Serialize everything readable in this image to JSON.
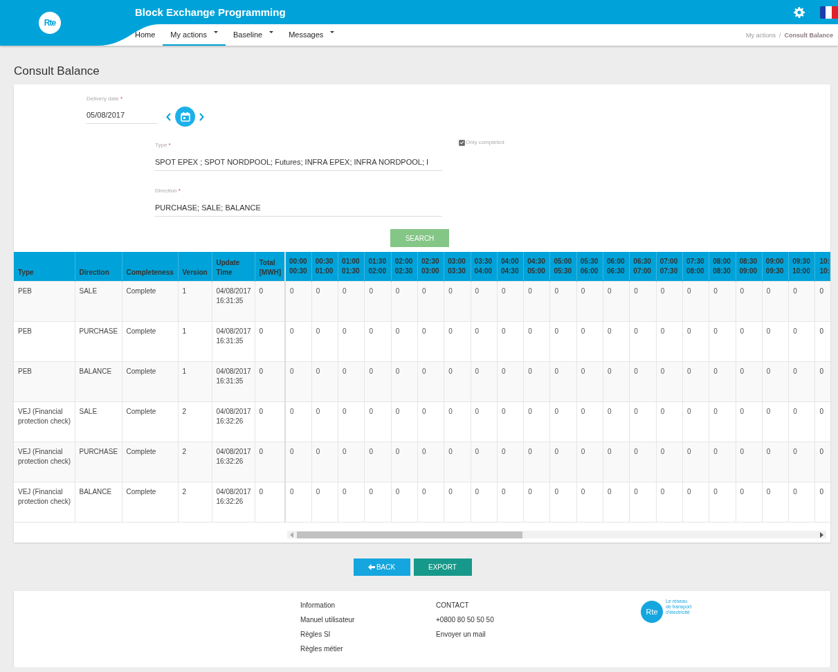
{
  "header": {
    "logo_text": "Rte",
    "title": "Block Exchange Programming"
  },
  "nav": [
    {
      "label": "Home",
      "selected": false,
      "dropdown": false
    },
    {
      "label": "My actions",
      "selected": true,
      "dropdown": true
    },
    {
      "label": "Baseline",
      "selected": false,
      "dropdown": true
    },
    {
      "label": "Messages",
      "selected": false,
      "dropdown": true
    }
  ],
  "breadcrumb": {
    "items": [
      "My actions",
      "Consult Balance"
    ],
    "separator": "/"
  },
  "page_title": "Consult Balance",
  "form": {
    "delivery_date": {
      "label": "Delivery date",
      "marker": "*",
      "value": "05/08/2017"
    },
    "type": {
      "label": "Type",
      "marker": "*",
      "value": "SPOT EPEX ; SPOT NORDPOOL; Futures; INFRA EPEX; INFRA NORDPOOL; I"
    },
    "only_completed": {
      "label": "Only completed",
      "checked": true
    },
    "direction": {
      "label": "Direction",
      "marker": "*",
      "value": "PURCHASE; SALE; BALANCE"
    },
    "search_button": {
      "label": "SEARCH",
      "disabled": true
    }
  },
  "table": {
    "columns": [
      {
        "label": "Type",
        "kind": "type"
      },
      {
        "label": "Direction",
        "kind": "direction"
      },
      {
        "label": "Completeness",
        "kind": "completeness"
      },
      {
        "label": "Version",
        "kind": "version"
      },
      {
        "label": "Update Time",
        "kind": "time"
      },
      {
        "label": "Total [MWH]",
        "kind": "total"
      },
      {
        "label": "00:00 00:30",
        "kind": "slot"
      },
      {
        "label": "00:30 01:00",
        "kind": "slot"
      },
      {
        "label": "01:00 01:30",
        "kind": "slot"
      },
      {
        "label": "01:30 02:00",
        "kind": "slot"
      },
      {
        "label": "02:00 02:30",
        "kind": "slot"
      },
      {
        "label": "02:30 03:00",
        "kind": "slot"
      },
      {
        "label": "03:00 03:30",
        "kind": "slot"
      },
      {
        "label": "03:30 04:00",
        "kind": "slot"
      },
      {
        "label": "04:00 04:30",
        "kind": "slot"
      },
      {
        "label": "04:30 05:00",
        "kind": "slot"
      },
      {
        "label": "05:00 05:30",
        "kind": "slot"
      },
      {
        "label": "05:30 06:00",
        "kind": "slot"
      },
      {
        "label": "06:00 06:30",
        "kind": "slot"
      },
      {
        "label": "06:30 07:00",
        "kind": "slot"
      },
      {
        "label": "07:00 07:30",
        "kind": "slot"
      },
      {
        "label": "07:30 08:00",
        "kind": "slot"
      },
      {
        "label": "08:00 08:30",
        "kind": "slot"
      },
      {
        "label": "08:30 09:00",
        "kind": "slot"
      },
      {
        "label": "09:00 09:30",
        "kind": "slot"
      },
      {
        "label": "09:30 10:00",
        "kind": "slot"
      },
      {
        "label": "10: 10:",
        "kind": "partial"
      }
    ],
    "rows": [
      [
        "PEB",
        "SALE",
        "Complete",
        "1",
        "04/08/2017 16:31:35",
        "0",
        "0",
        "0",
        "0",
        "0",
        "0",
        "0",
        "0",
        "0",
        "0",
        "0",
        "0",
        "0",
        "0",
        "0",
        "0",
        "0",
        "0",
        "0",
        "0",
        "0",
        "0"
      ],
      [
        "PEB",
        "PURCHASE",
        "Complete",
        "1",
        "04/08/2017 16:31:35",
        "0",
        "0",
        "0",
        "0",
        "0",
        "0",
        "0",
        "0",
        "0",
        "0",
        "0",
        "0",
        "0",
        "0",
        "0",
        "0",
        "0",
        "0",
        "0",
        "0",
        "0",
        "0"
      ],
      [
        "PEB",
        "BALANCE",
        "Complete",
        "1",
        "04/08/2017 16:31:35",
        "0",
        "0",
        "0",
        "0",
        "0",
        "0",
        "0",
        "0",
        "0",
        "0",
        "0",
        "0",
        "0",
        "0",
        "0",
        "0",
        "0",
        "0",
        "0",
        "0",
        "0",
        "0"
      ],
      [
        "VEJ (Financial protection check)",
        "SALE",
        "Complete",
        "2",
        "04/08/2017 16:32:26",
        "0",
        "0",
        "0",
        "0",
        "0",
        "0",
        "0",
        "0",
        "0",
        "0",
        "0",
        "0",
        "0",
        "0",
        "0",
        "0",
        "0",
        "0",
        "0",
        "0",
        "0",
        "0"
      ],
      [
        "VEJ (Financial protection check)",
        "PURCHASE",
        "Complete",
        "2",
        "04/08/2017 16:32:26",
        "0",
        "0",
        "0",
        "0",
        "0",
        "0",
        "0",
        "0",
        "0",
        "0",
        "0",
        "0",
        "0",
        "0",
        "0",
        "0",
        "0",
        "0",
        "0",
        "0",
        "0",
        "0"
      ],
      [
        "VEJ (Financial protection check)",
        "BALANCE",
        "Complete",
        "2",
        "04/08/2017 16:32:26",
        "0",
        "0",
        "0",
        "0",
        "0",
        "0",
        "0",
        "0",
        "0",
        "0",
        "0",
        "0",
        "0",
        "0",
        "0",
        "0",
        "0",
        "0",
        "0",
        "0",
        "0",
        "0"
      ]
    ]
  },
  "actions": [
    {
      "label": "BACK",
      "kind": "back"
    },
    {
      "label": "EXPORT",
      "kind": "export"
    }
  ],
  "footer": {
    "information": [
      "Information",
      "Manuel utilisateur",
      "Règles SI",
      "Règles métier"
    ],
    "contact": [
      "CONTACT",
      "+0800 80 50 50 50",
      "Envoyer un mail"
    ],
    "logo_text": "Rte",
    "tagline": [
      "Le réseau",
      "de transport",
      "d'électricité"
    ]
  }
}
